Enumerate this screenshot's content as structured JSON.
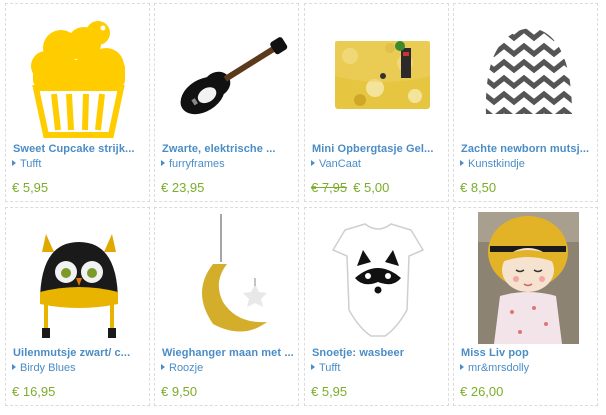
{
  "products": [
    {
      "title": "Sweet Cupcake strijk...",
      "seller": "Tufft",
      "price": "€ 5,95",
      "old_price": "",
      "image": "cupcake-image"
    },
    {
      "title": "Zwarte, elektrische ...",
      "seller": "furryframes",
      "price": "€ 23,95",
      "old_price": "",
      "image": "guitar-image"
    },
    {
      "title": "Mini Opbergtasje Gel...",
      "seller": "VanCaat",
      "price": "€ 5,00",
      "old_price": "€ 7,95",
      "image": "pouch-image"
    },
    {
      "title": "Zachte newborn mutsj...",
      "seller": "Kunstkindje",
      "price": "€ 8,50",
      "old_price": "",
      "image": "chevron-hat-image"
    },
    {
      "title": "Uilenmutsje zwart/ c...",
      "seller": "Birdy Blues",
      "price": "€ 16,95",
      "old_price": "",
      "image": "owl-hat-image"
    },
    {
      "title": "Wieghanger maan met ...",
      "seller": "Roozje",
      "price": "€ 9,50",
      "old_price": "",
      "image": "moon-mobile-image"
    },
    {
      "title": "Snoetje: wasbeer",
      "seller": "Tufft",
      "price": "€ 5,95",
      "old_price": "",
      "image": "raccoon-onesie-image"
    },
    {
      "title": "Miss Liv pop",
      "seller": "mr&mrsdolly",
      "price": "€ 26,00",
      "old_price": "",
      "image": "doll-image"
    }
  ],
  "colors": {
    "link": "#4a8dc6",
    "price": "#7bad2a",
    "border": "#dcdcdc"
  }
}
